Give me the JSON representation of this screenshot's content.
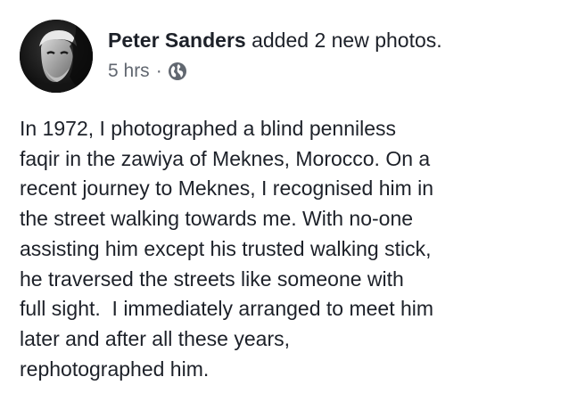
{
  "post": {
    "author_name": "Peter Sanders",
    "action": "added 2 new photos.",
    "timestamp": "5 hrs",
    "separator": "·",
    "privacy_icon": "globe-icon",
    "avatar_icon": "profile-photo",
    "text_lines": [
      "In 1972, I photographed a blind penniless",
      "faqir in the zawiya of Meknes, Morocco. On a",
      "recent journey to Meknes, I recognised him in",
      "the street walking towards me. With no-one",
      "assisting him except his trusted walking stick,",
      "he traversed the streets like someone with",
      "full sight.  I immediately arranged to meet him",
      "later and after all these years,",
      "rephotographed him."
    ]
  },
  "colors": {
    "text": "#1d2129",
    "meta": "#616770",
    "background": "#ffffff"
  }
}
